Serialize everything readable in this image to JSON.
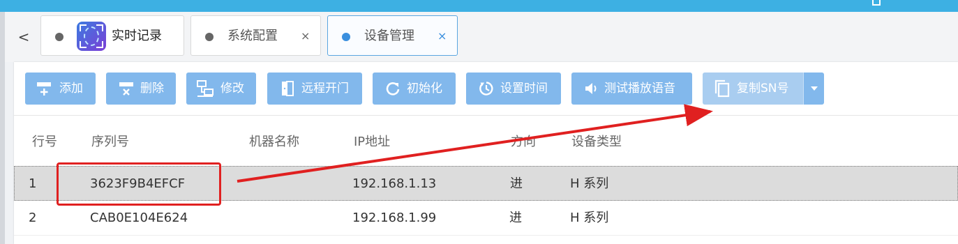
{
  "tabs": [
    {
      "label": "实时记录",
      "closable": false,
      "active": false
    },
    {
      "label": "系统配置",
      "closable": true,
      "active": false
    },
    {
      "label": "设备管理",
      "closable": true,
      "active": true
    }
  ],
  "tab_close_glyph": "×",
  "tab_prev_glyph": "<",
  "toolbar": {
    "add": "添加",
    "delete": "删除",
    "edit": "修改",
    "remote_open": "远程开门",
    "init": "初始化",
    "set_time": "设置时间",
    "test_voice": "测试播放语音",
    "copy_sn": "复制SN号"
  },
  "table": {
    "headers": [
      "行号",
      "序列号",
      "机器名称",
      "IP地址",
      "方向",
      "设备类型"
    ],
    "rows": [
      {
        "no": "1",
        "sn": "3623F9B4EFCF",
        "name": "",
        "ip": "192.168.1.13",
        "dir": "进",
        "type": "H 系列",
        "selected": true
      },
      {
        "no": "2",
        "sn": "CAB0E104E624",
        "name": "",
        "ip": "192.168.1.99",
        "dir": "进",
        "type": "H 系列",
        "selected": false
      }
    ]
  },
  "colors": {
    "topbar": "#3db0e3",
    "button": "#82b8ec",
    "annotation": "#e02020",
    "active_dot": "#3a8fde"
  }
}
